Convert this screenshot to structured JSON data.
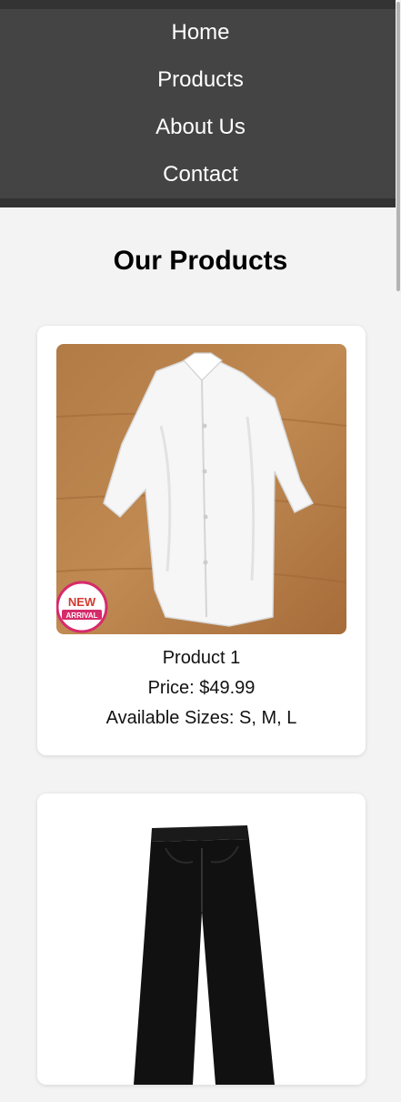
{
  "nav": {
    "items": [
      {
        "label": "Home"
      },
      {
        "label": "Products"
      },
      {
        "label": "About Us"
      },
      {
        "label": "Contact"
      }
    ]
  },
  "main": {
    "title": "Our Products",
    "products": [
      {
        "name": "Product 1",
        "price": "Price: $49.99",
        "sizes": "Available Sizes: S, M, L",
        "image": "white-shirt-photo",
        "badge": "NEW ARRIVAL"
      },
      {
        "image": "black-pants-photo"
      }
    ]
  },
  "colors": {
    "nav_bg": "#444444",
    "nav_text": "#ffffff",
    "page_bg": "#f3f3f3",
    "card_bg": "#ffffff"
  }
}
